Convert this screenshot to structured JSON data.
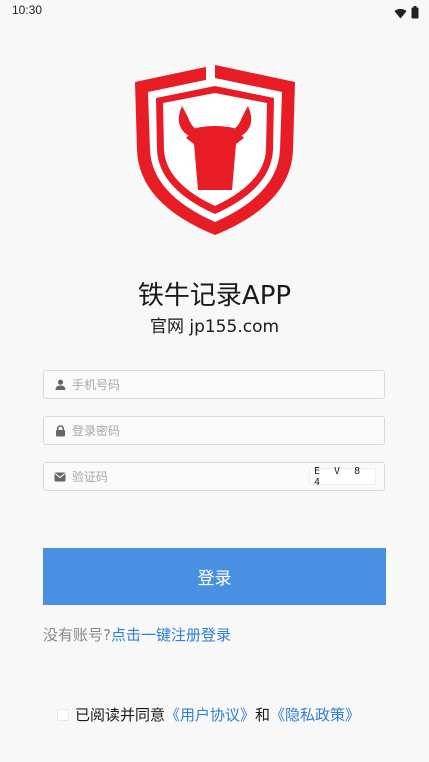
{
  "status_bar": {
    "time": "10:30",
    "icons": [
      "wifi-icon",
      "battery-icon"
    ]
  },
  "logo": {
    "icon": "bull-shield-logo",
    "color": "#e81c24"
  },
  "app": {
    "title": "铁牛记录APP",
    "subtitle": "官网 jp155.com"
  },
  "form": {
    "phone": {
      "placeholder": "手机号码",
      "value": "",
      "icon": "user-icon"
    },
    "password": {
      "placeholder": "登录密码",
      "value": "",
      "icon": "lock-icon"
    },
    "code": {
      "placeholder": "验证码",
      "value": "",
      "icon": "mail-icon",
      "captcha": "E V 8 4"
    },
    "login_label": "登录"
  },
  "register": {
    "prompt": "没有账号?",
    "link": "点击一键注册登录"
  },
  "agreement": {
    "prefix": "已阅读并同意",
    "user_agreement": "《用户协议》",
    "conjunction": "和",
    "privacy_policy": "《隐私政策》"
  },
  "colors": {
    "accent": "#4a90e2",
    "link": "#2e7fd6",
    "brand": "#e81c24"
  }
}
